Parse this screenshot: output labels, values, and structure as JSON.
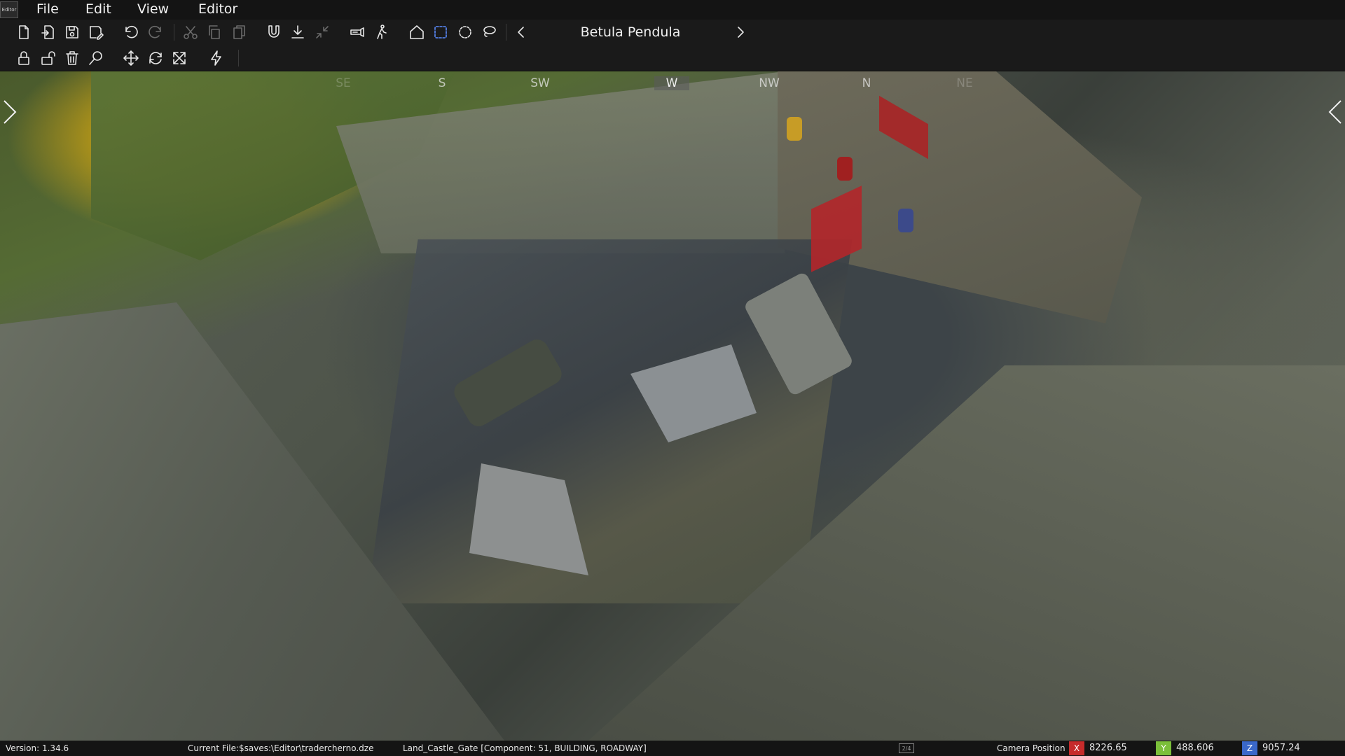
{
  "app": {
    "icon_text": "Editor"
  },
  "menu": {
    "items": [
      "File",
      "Edit",
      "View",
      "Editor"
    ]
  },
  "toolbar": {
    "row1": [
      "new-file-icon",
      "open-file-icon",
      "save-icon",
      "save-as-icon",
      "undo-icon",
      "redo-icon",
      "cut-icon",
      "copy-icon",
      "paste-icon",
      "magnet-icon",
      "ground-snap-icon",
      "collapse-icon",
      "flashlight-icon",
      "walk-icon",
      "home-icon",
      "box-select-icon",
      "circle-select-icon",
      "lasso-select-icon"
    ],
    "row2": [
      "lock-icon",
      "unlock-icon",
      "delete-icon",
      "search-icon",
      "move-icon",
      "rotate-icon",
      "scale-icon",
      "lightning-icon"
    ],
    "active": "box-select-icon",
    "disabled": [
      "redo-icon",
      "cut-icon",
      "copy-icon",
      "paste-icon",
      "collapse-icon"
    ]
  },
  "brush": {
    "title": "Betula Pendula"
  },
  "compass": {
    "labels": [
      "SE",
      "S",
      "SW",
      "W",
      "NW",
      "N",
      "NE"
    ],
    "current": "W"
  },
  "status": {
    "version": "Version:  1.34.6",
    "current_file": "Current File:$saves:\\Editor\\tradercherno.dze",
    "selected_object": "Land_Castle_Gate [Component: 51, BUILDING, ROADWAY]",
    "camera_icon_text": "2/4",
    "camera_label": "Camera Position",
    "x_label": "X",
    "x_value": "8226.65",
    "y_label": "Y",
    "y_value": "488.606",
    "z_label": "Z",
    "z_value": "9057.24",
    "colors": {
      "x": "#c62b2b",
      "y": "#7bbf3a",
      "z": "#3a68c9"
    }
  }
}
